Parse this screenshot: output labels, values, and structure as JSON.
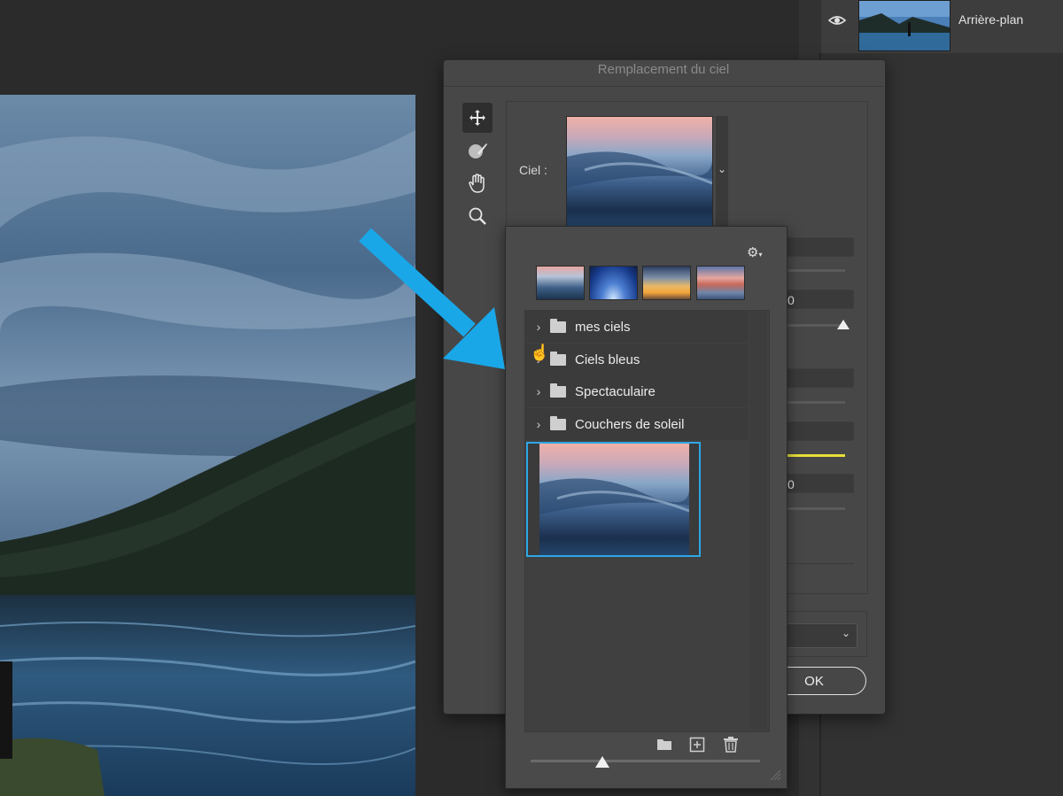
{
  "layers": {
    "layer_name": "Arrière-plan"
  },
  "dialog": {
    "title": "Remplacement du ciel",
    "sky_label": "Ciel :",
    "field_values": [
      "",
      "0",
      "",
      "",
      "0"
    ],
    "ok_label": "OK"
  },
  "picker": {
    "folders": [
      {
        "label": "mes ciels"
      },
      {
        "label": "Ciels bleus"
      },
      {
        "label": "Spectaculaire"
      },
      {
        "label": "Couchers de soleil"
      }
    ]
  },
  "icons": {
    "eye": "eye-icon",
    "move": "move-tool-icon",
    "brush": "sky-brush-icon",
    "hand": "hand-tool-icon",
    "zoom": "zoom-icon",
    "gear": "gear-icon",
    "folder": "folder-icon",
    "new": "new-preset-icon",
    "trash": "trash-icon"
  },
  "colors": {
    "selection": "#2ea7e6",
    "annotation_arrow": "#1aa7e8",
    "slider_highlight": "#e6e03a"
  }
}
